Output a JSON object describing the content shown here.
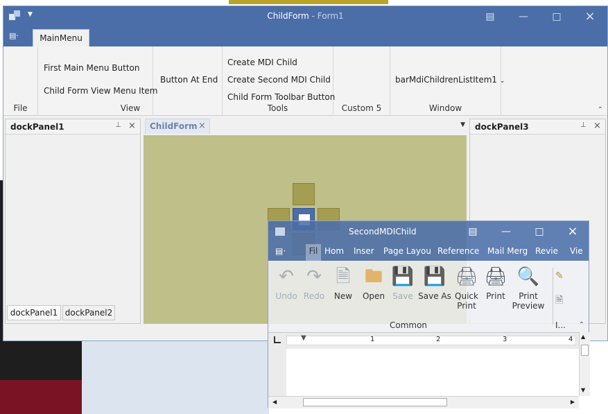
{
  "background": {
    "colors": {
      "dark": "#1e1e1e",
      "red": "#7a1424",
      "light": "#dce4ef"
    }
  },
  "main_window": {
    "title": "ChildForm",
    "title_suffix": "- Form1",
    "accent": "#4b6ea8"
  },
  "ribbon": {
    "tab_active": "MainMenu",
    "groups": {
      "file": {
        "caption": "File"
      },
      "view": {
        "caption": "View",
        "items": [
          "First Main Menu Button",
          "Child Form View Menu Item"
        ]
      },
      "button_at_end": {
        "label": "Button At End"
      },
      "tools": {
        "caption": "Tools",
        "items": [
          "Create MDI Child",
          "Create Second MDI Child",
          "Child Form Toolbar Button"
        ]
      },
      "custom5": {
        "caption": "Custom 5"
      },
      "window": {
        "caption": "Window",
        "item": "barMdiChildrenListItem1"
      }
    }
  },
  "dock_panels": {
    "left": {
      "title": "dockPanel1",
      "tabs": [
        "dockPanel1",
        "dockPanel2"
      ]
    },
    "right": {
      "title": "dockPanel3"
    }
  },
  "document": {
    "tab": "ChildForm"
  },
  "second_child": {
    "title": "SecondMDIChild",
    "tabs": [
      "Fil",
      "Hom",
      "Inser",
      "Page Layou",
      "Reference",
      "Mail Merg",
      "Revie",
      "Vie"
    ],
    "buttons": [
      {
        "label": "Undo",
        "enabled": false,
        "icon": "undo-icon"
      },
      {
        "label": "Redo",
        "enabled": false,
        "icon": "redo-icon"
      },
      {
        "label": "New",
        "enabled": true,
        "icon": "new-doc-icon"
      },
      {
        "label": "Open",
        "enabled": true,
        "icon": "folder-icon"
      },
      {
        "label": "Save",
        "enabled": false,
        "icon": "save-icon"
      },
      {
        "label": "Save As",
        "enabled": true,
        "icon": "save-as-icon"
      },
      {
        "label": "Quick Print",
        "enabled": true,
        "icon": "printer-icon"
      },
      {
        "label": "Print",
        "enabled": true,
        "icon": "print-dialog-icon"
      },
      {
        "label": "Print Preview",
        "enabled": true,
        "icon": "print-preview-icon"
      }
    ],
    "group_caption": "Common",
    "next_group_caption": "I...",
    "ruler_numbers": [
      "1",
      "2",
      "3",
      "4"
    ]
  }
}
